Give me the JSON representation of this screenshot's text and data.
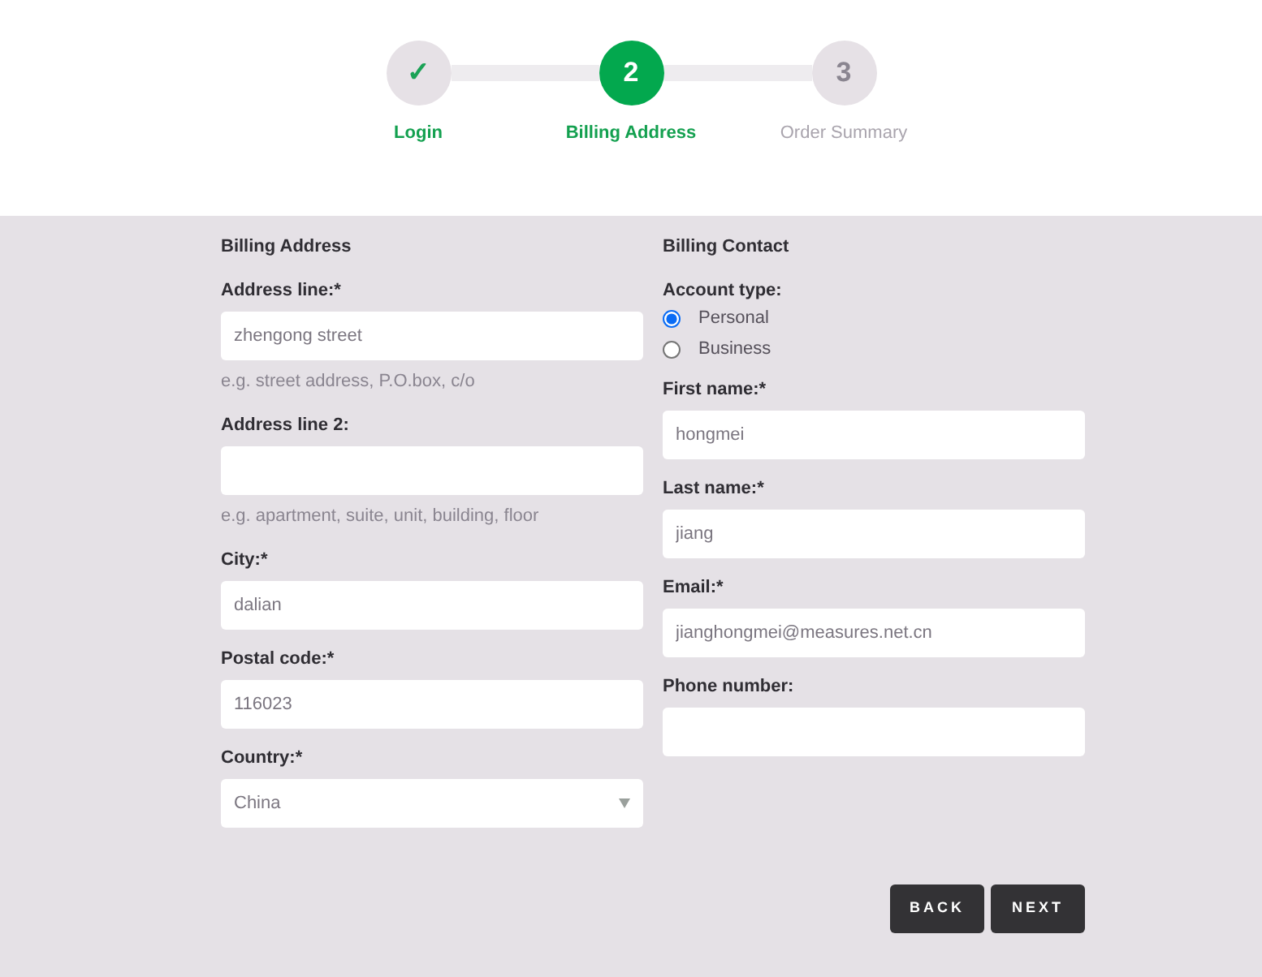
{
  "steps": [
    {
      "kind": "done",
      "number": "✓",
      "label": "Login"
    },
    {
      "kind": "current",
      "number": "2",
      "label": "Billing Address"
    },
    {
      "kind": "upcoming",
      "number": "3",
      "label": "Order Summary"
    }
  ],
  "billing_address": {
    "title": "Billing Address",
    "fields": [
      {
        "kind": "text",
        "label": "Address line:*",
        "value": "zhengong street",
        "hint": "e.g. street address, P.O.box, c/o"
      },
      {
        "kind": "text",
        "label": "Address line 2:",
        "hint": "e.g. apartment, suite, unit, building, floor"
      },
      {
        "kind": "text",
        "label": "City:*",
        "value": "dalian"
      },
      {
        "kind": "text",
        "label": "Postal code:*",
        "value": "116023"
      },
      {
        "kind": "select",
        "label": "Country:*",
        "value": "China"
      }
    ]
  },
  "billing_contact": {
    "title": "Billing Contact",
    "account_type": {
      "label": "Account type:",
      "options": [
        {
          "label": "Personal",
          "selected": true
        },
        {
          "label": "Business",
          "selected": false
        }
      ]
    },
    "fields": [
      {
        "kind": "text",
        "label": "First name:*",
        "value": "hongmei"
      },
      {
        "kind": "text",
        "label": "Last name:*",
        "value": "jiang"
      },
      {
        "kind": "text",
        "label": "Email:*",
        "value": "jianghongmei@measures.net.cn"
      },
      {
        "kind": "text",
        "label": "Phone number:"
      }
    ]
  },
  "buttons": [
    "BACK",
    "NEXT"
  ]
}
